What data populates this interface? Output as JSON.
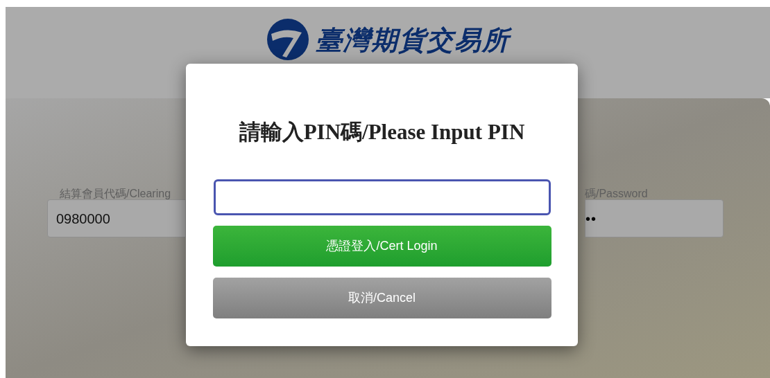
{
  "header": {
    "logo_text": "臺灣期貨交易所"
  },
  "login_form": {
    "fields": [
      {
        "label": "結算會員代碼/Clearing",
        "value": "0980000",
        "kind": "text"
      },
      {
        "label": "碼/Password",
        "value": "••",
        "kind": "password"
      }
    ]
  },
  "dialog": {
    "title": "請輸入PIN碼/Please Input PIN",
    "pin_field": {
      "focused": true
    },
    "buttons": [
      {
        "label": "憑證登入/Cert Login",
        "kind": "primary"
      },
      {
        "label": "取消/Cancel",
        "kind": "secondary"
      }
    ]
  }
}
